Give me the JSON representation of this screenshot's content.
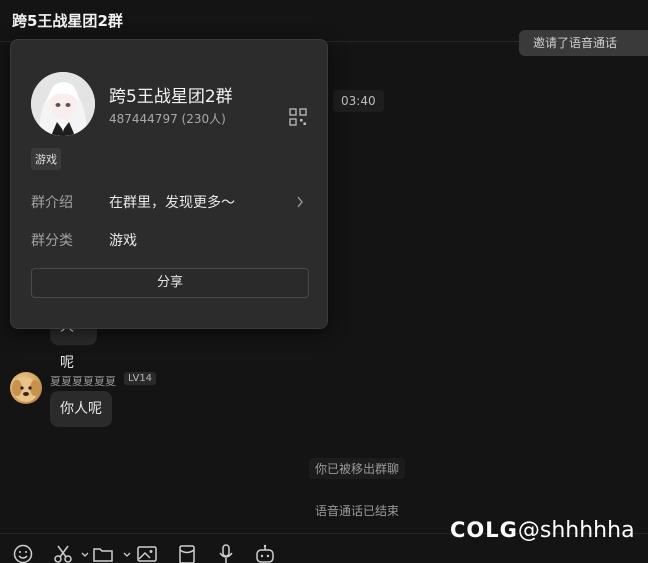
{
  "header": {
    "title": "跨5王战星团2群"
  },
  "chat": {
    "notice_pill": "邀请了语音通话",
    "time": "03:40",
    "bubble_partial": "人呢",
    "sender_name": "夏夏夏夏夏夏",
    "sender_level": "LV14",
    "bubble_message": "你人呢",
    "system_removed": "你已被移出群聊",
    "system_call_ended": "语音通话已结束"
  },
  "card": {
    "group_name": "跨5王战星团2群",
    "group_id": "487444797 (230人)",
    "tag": "游戏",
    "intro_label": "群介绍",
    "intro_value": "在群里，发现更多～",
    "category_label": "群分类",
    "category_value": "游戏",
    "share_label": "分享"
  },
  "toolbar": {
    "icons": [
      "emoji-icon",
      "scissors-icon",
      "folder-icon",
      "image-icon",
      "red-packet-icon",
      "microphone-icon",
      "robot-icon"
    ]
  },
  "watermark": {
    "logo": "COLG",
    "handle": "@shhhhha"
  }
}
